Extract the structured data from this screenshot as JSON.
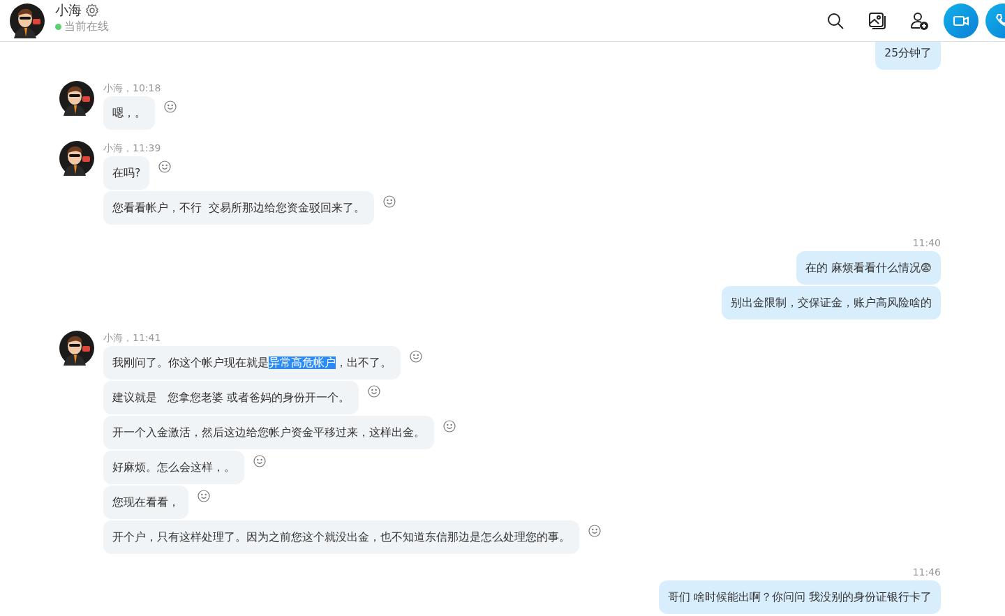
{
  "header": {
    "name": "小海",
    "status": "当前在线",
    "online": true,
    "actions": [
      {
        "kind": "search"
      },
      {
        "kind": "image"
      },
      {
        "kind": "add-contact"
      },
      {
        "kind": "video"
      },
      {
        "kind": "call"
      }
    ]
  },
  "groups": [
    {
      "kind": "outgoing",
      "bubbles": [
        {
          "parts": [
            {
              "text": "25分钟了",
              "selected": false
            }
          ]
        }
      ]
    },
    {
      "kind": "incoming",
      "meta": "小海，10:18",
      "bubbles": [
        {
          "parts": [
            {
              "text": "嗯，。",
              "selected": false
            }
          ]
        }
      ]
    },
    {
      "kind": "incoming",
      "meta": "小海，11:39",
      "bubbles": [
        {
          "parts": [
            {
              "text": "在吗?",
              "selected": false
            }
          ]
        },
        {
          "parts": [
            {
              "text": "您看看帐户，不行  交易所那边给您资金驳回来了。",
              "selected": false
            }
          ]
        }
      ]
    },
    {
      "kind": "outgoing",
      "meta": "11:40",
      "bubbles": [
        {
          "parts": [
            {
              "text": "在的 麻烦看看什么情况😨",
              "selected": false
            }
          ]
        },
        {
          "parts": [
            {
              "text": "别出金限制，交保证金，账户高风险啥的",
              "selected": false
            }
          ]
        }
      ]
    },
    {
      "kind": "incoming",
      "meta": "小海，11:41",
      "bubbles": [
        {
          "parts": [
            {
              "text": "我刚问了。你这个帐户现在就是",
              "selected": false
            },
            {
              "text": "异常高危帐户",
              "selected": true
            },
            {
              "text": "，出不了。",
              "selected": false
            }
          ]
        },
        {
          "parts": [
            {
              "text": "建议就是   您拿您老婆 或者爸妈的身份开一个。",
              "selected": false
            }
          ]
        },
        {
          "parts": [
            {
              "text": "开一个入金激活，然后这边给您帐户资金平移过来，这样出金。",
              "selected": false
            }
          ]
        },
        {
          "parts": [
            {
              "text": "好麻烦。怎么会这样，。",
              "selected": false
            }
          ]
        },
        {
          "parts": [
            {
              "text": "您现在看看，",
              "selected": false
            }
          ]
        },
        {
          "parts": [
            {
              "text": "开个户，只有这样处理了。因为之前您这个就没出金，也不知道东信那边是怎么处理您的事。",
              "selected": false
            }
          ]
        }
      ]
    },
    {
      "kind": "outgoing",
      "meta": "11:46",
      "bubbles": [
        {
          "parts": [
            {
              "text": "哥们 啥时候能出啊？你问问 我没别的身份证银行卡了",
              "selected": false
            }
          ]
        }
      ]
    }
  ]
}
